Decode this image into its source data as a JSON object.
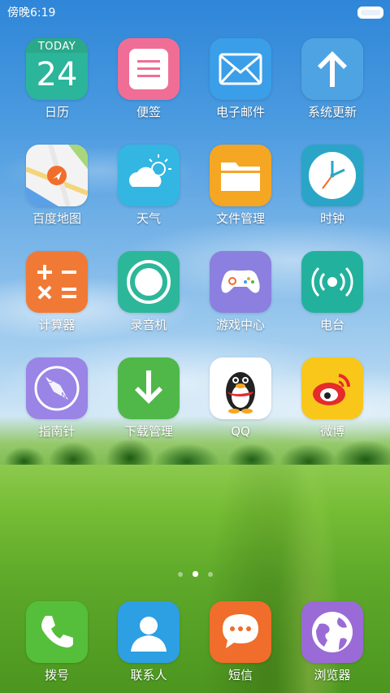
{
  "status_bar": {
    "time": "傍晚6:19",
    "battery_icon": "battery-icon"
  },
  "apps": [
    {
      "label": "日历",
      "icon": "calendar-icon",
      "today": "TODAY",
      "day": "24"
    },
    {
      "label": "便签",
      "icon": "notes-icon"
    },
    {
      "label": "电子邮件",
      "icon": "email-icon"
    },
    {
      "label": "系统更新",
      "icon": "update-arrow-icon"
    },
    {
      "label": "百度地图",
      "icon": "map-icon"
    },
    {
      "label": "天气",
      "icon": "weather-icon"
    },
    {
      "label": "文件管理",
      "icon": "folder-icon"
    },
    {
      "label": "时钟",
      "icon": "clock-icon"
    },
    {
      "label": "计算器",
      "icon": "calculator-icon"
    },
    {
      "label": "录音机",
      "icon": "recorder-icon"
    },
    {
      "label": "游戏中心",
      "icon": "gamepad-icon"
    },
    {
      "label": "电台",
      "icon": "radio-icon"
    },
    {
      "label": "指南针",
      "icon": "compass-icon"
    },
    {
      "label": "下载管理",
      "icon": "download-icon"
    },
    {
      "label": "QQ",
      "icon": "qq-penguin-icon"
    },
    {
      "label": "微博",
      "icon": "weibo-icon"
    }
  ],
  "page_indicator": {
    "pages": 3,
    "current": 2
  },
  "dock": [
    {
      "label": "拨号",
      "icon": "phone-icon"
    },
    {
      "label": "联系人",
      "icon": "contacts-icon"
    },
    {
      "label": "短信",
      "icon": "messages-icon"
    },
    {
      "label": "浏览器",
      "icon": "browser-icon"
    }
  ],
  "colors": {
    "calendar": "#2bb59a",
    "notes": "#f06e96",
    "email": "#3a9ee8",
    "update": "#4ea3e3",
    "maps": "#f3f3f3",
    "weather": "#33b6e2",
    "files": "#f5a623",
    "clock": "#2aa5c7",
    "calculator": "#f07a35",
    "recorder": "#2db79a",
    "game": "#8b7fe0",
    "radio": "#22b19c",
    "compass": "#9a84e6",
    "download": "#4fb848",
    "qq": "#ffffff",
    "weibo": "#f8c71a",
    "phone": "#55bf3b",
    "contacts": "#2d9fe3",
    "messages": "#f06d2b",
    "browser": "#9a6bd6"
  }
}
